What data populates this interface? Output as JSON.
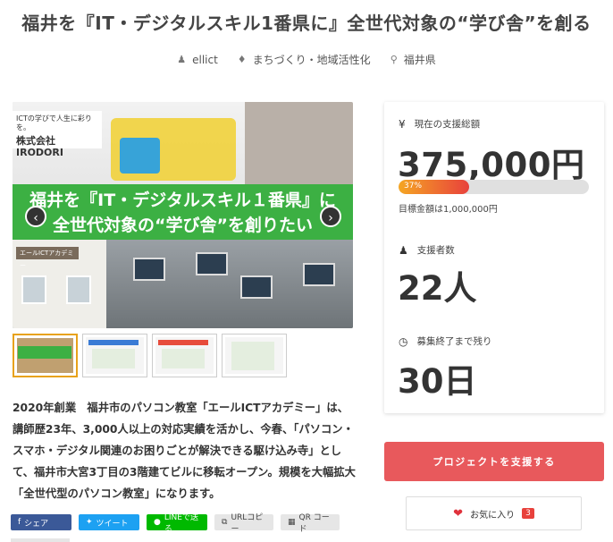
{
  "project": {
    "title": "福井を『IT・デジタルスキル1番県に』全世代対象の“学び舎”を創る",
    "author": "ellict",
    "category": "まちづくり・地域活性化",
    "location": "福井県"
  },
  "hero": {
    "logo_small": "ICTの学びで人生に彩りを。",
    "logo_company": "株式会社 IRODORI",
    "banner_line1": "福井を『IT・デジタルスキル１番県』に",
    "banner_line2": "全世代対象の“学び舎”を創りたい",
    "building_sign": "エールICTアカデミー",
    "prev_icon": "‹",
    "next_icon": "›"
  },
  "thumbnails": [
    {
      "active": true
    },
    {
      "active": false
    },
    {
      "active": false
    },
    {
      "active": false
    }
  ],
  "description": "2020年創業　福井市のパソコン教室「エールICTアカデミー」は、講師歴23年、3,000人以上の対応実績を活かし、今春、「パソコン・スマホ・デジタル関連のお困りごとが解決できる駆け込み寺」として、福井市大宮3丁目の3階建てビルに移転オープン。規模を大幅拡大「全世代型のパソコン教室」になります。",
  "share": {
    "facebook": "シェア",
    "twitter": "ツイート",
    "line": "LINEで送る",
    "url": "URLコピー",
    "qr": "QR コード"
  },
  "stats": {
    "total_label": "現在の支援総額",
    "total_amount": "375,000円",
    "progress_percent": 37,
    "progress_label": "37%",
    "goal_text": "目標金額は1,000,000円",
    "supporters_label": "支援者数",
    "supporters_value": "22人",
    "remaining_label": "募集終了まで残り",
    "remaining_value": "30日"
  },
  "actions": {
    "support_label": "プロジェクトを支援する",
    "favorite_label": "お気に入り",
    "favorite_count": "3"
  }
}
